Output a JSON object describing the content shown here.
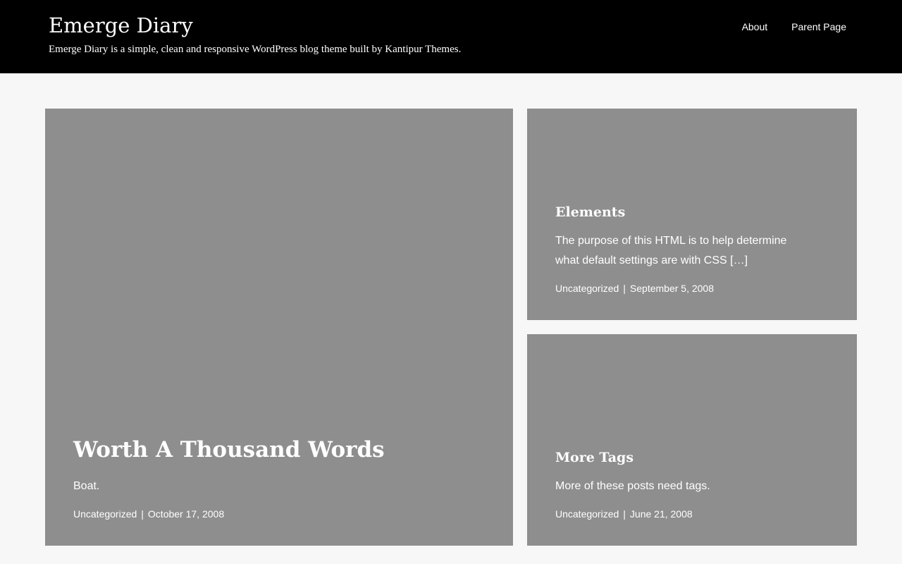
{
  "site": {
    "title": "Emerge Diary",
    "description": "Emerge Diary is a simple, clean and responsive WordPress blog theme built by Kantipur Themes."
  },
  "nav": {
    "items": [
      {
        "label": "About"
      },
      {
        "label": "Parent Page"
      }
    ]
  },
  "posts": [
    {
      "title": "Worth A Thousand Words",
      "excerpt": "Boat.",
      "category": "Uncategorized",
      "separator": "|",
      "date": "October 17, 2008"
    },
    {
      "title": "Elements",
      "excerpt": "The purpose of this HTML is to help determine what default settings are with CSS […]",
      "category": "Uncategorized",
      "separator": "|",
      "date": "September 5, 2008"
    },
    {
      "title": "More Tags",
      "excerpt": "More of these posts need tags.",
      "category": "Uncategorized",
      "separator": "|",
      "date": "June 21, 2008"
    }
  ],
  "colors": {
    "header_bg": "#000000",
    "page_bg": "#f7f7f7",
    "card_bg": "#8e8e8e",
    "text": "#ffffff"
  }
}
